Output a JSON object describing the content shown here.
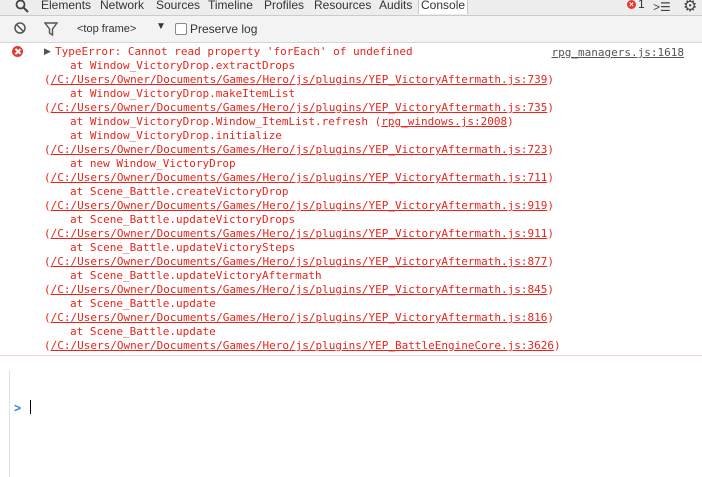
{
  "tabs": [
    "Elements",
    "Network",
    "Sources",
    "Timeline",
    "Profiles",
    "Resources",
    "Audits",
    "Console"
  ],
  "error_count": "1",
  "toolbar": {
    "frame_label": "<top frame>",
    "preserve_log_label": "Preserve log"
  },
  "error": {
    "message": "TypeError: Cannot read property 'forEach' of undefined",
    "source": "rpg_managers.js:1618",
    "stack": [
      {
        "fn": "at Window_VictoryDrop.extractDrops",
        "loc": "/C:/Users/Owner/Documents/Games/Hero/js/plugins/YEP_VictoryAftermath.js:739"
      },
      {
        "fn": "at Window_VictoryDrop.makeItemList",
        "loc": "/C:/Users/Owner/Documents/Games/Hero/js/plugins/YEP_VictoryAftermath.js:735"
      },
      {
        "fn": "at Window_VictoryDrop.Window_ItemList.refresh",
        "inline_loc": "rpg_windows.js:2008"
      },
      {
        "fn": "at Window_VictoryDrop.initialize",
        "loc": "/C:/Users/Owner/Documents/Games/Hero/js/plugins/YEP_VictoryAftermath.js:723"
      },
      {
        "fn": "at new Window_VictoryDrop",
        "loc": "/C:/Users/Owner/Documents/Games/Hero/js/plugins/YEP_VictoryAftermath.js:711"
      },
      {
        "fn": "at Scene_Battle.createVictoryDrop",
        "loc": "/C:/Users/Owner/Documents/Games/Hero/js/plugins/YEP_VictoryAftermath.js:919"
      },
      {
        "fn": "at Scene_Battle.updateVictoryDrops",
        "loc": "/C:/Users/Owner/Documents/Games/Hero/js/plugins/YEP_VictoryAftermath.js:911"
      },
      {
        "fn": "at Scene_Battle.updateVictorySteps",
        "loc": "/C:/Users/Owner/Documents/Games/Hero/js/plugins/YEP_VictoryAftermath.js:877"
      },
      {
        "fn": "at Scene_Battle.updateVictoryAftermath",
        "loc": "/C:/Users/Owner/Documents/Games/Hero/js/plugins/YEP_VictoryAftermath.js:845"
      },
      {
        "fn": "at Scene_Battle.update",
        "loc": "/C:/Users/Owner/Documents/Games/Hero/js/plugins/YEP_VictoryAftermath.js:816"
      },
      {
        "fn": "at Scene_Battle.update",
        "loc": "/C:/Users/Owner/Documents/Games/Hero/js/plugins/YEP_BattleEngineCore.js:3626"
      }
    ]
  },
  "colors": {
    "error_red": "#e8251c",
    "prompt_blue": "#2d7bd3"
  }
}
